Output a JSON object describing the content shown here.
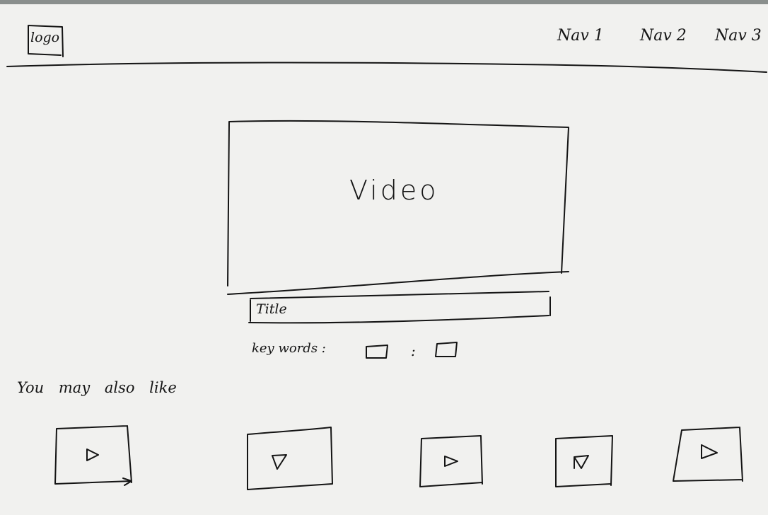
{
  "header": {
    "logo": "logo",
    "nav": [
      "Nav 1",
      "Nav 2",
      "Nav 3"
    ]
  },
  "video": {
    "label": "Video"
  },
  "title_field": {
    "value": "Title"
  },
  "keywords": {
    "label": "key words :",
    "separator": ":"
  },
  "recommendations": {
    "heading": "You may also like",
    "items": [
      "play",
      "play",
      "play",
      "play",
      "play"
    ]
  }
}
